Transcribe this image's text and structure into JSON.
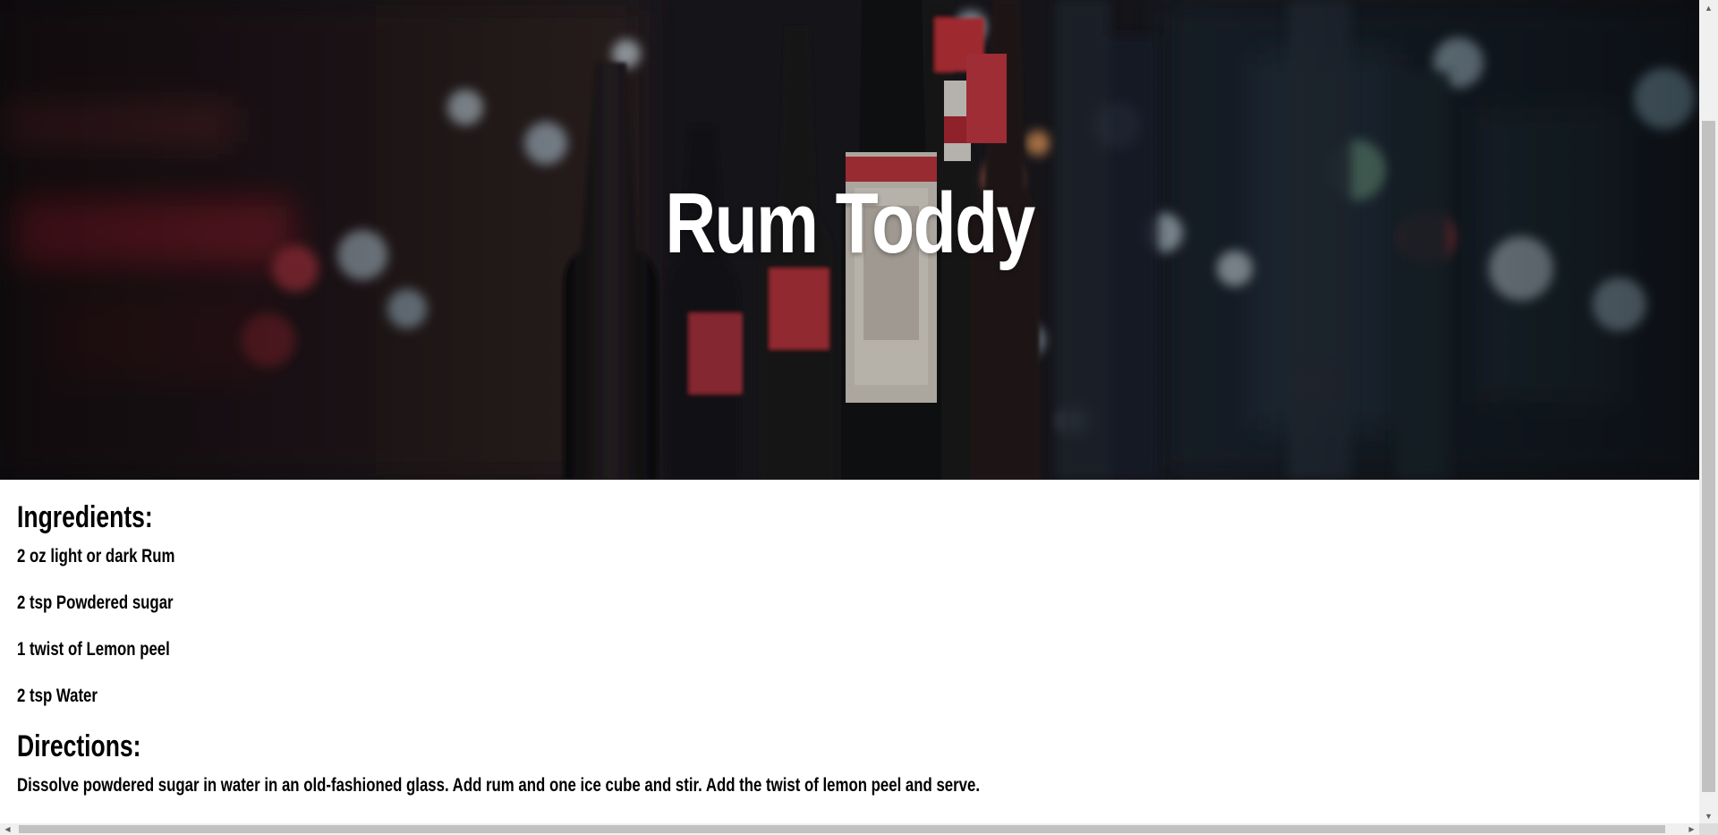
{
  "recipe": {
    "title": "Rum Toddy",
    "ingredients_heading": "Ingredients:",
    "ingredients": [
      "2 oz light or dark Rum",
      "2 tsp Powdered sugar",
      "1 twist of Lemon peel",
      "2 tsp Water"
    ],
    "directions_heading": "Directions:",
    "directions": "Dissolve powdered sugar in water in an old-fashioned glass. Add rum and one ice cube and stir. Add the twist of lemon peel and serve."
  },
  "hero_image": {
    "subject": "blurred-bar-bottles-photo"
  },
  "scrollbars": {
    "up_icon": "arrow-up-icon",
    "down_icon": "arrow-down-icon",
    "left_icon": "arrow-left-icon",
    "right_icon": "arrow-right-icon"
  }
}
